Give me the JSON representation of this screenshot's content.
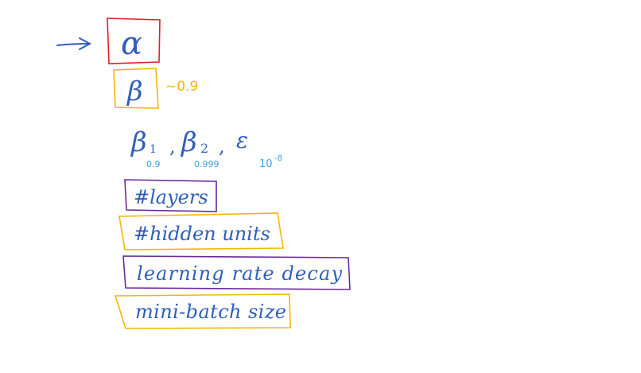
{
  "colors": {
    "ink": "#2f5fb8",
    "red": "#e0202a",
    "yellow": "#f2b705",
    "purple": "#6a2a9a",
    "light_blue": "#3aa0e0"
  },
  "notes": {
    "alpha": "α",
    "beta": "β",
    "beta_value": "~0.9",
    "beta1": "β",
    "beta1_sub": "1",
    "beta1_value": "0.9",
    "beta2": "β",
    "beta2_sub": "2",
    "beta2_value": "0.999",
    "epsilon": "ε",
    "epsilon_value": "10",
    "epsilon_exp": "-8",
    "separator1": ",",
    "separator2": ",",
    "layers": "#layers",
    "hidden_units": "#hidden units",
    "lr_decay": "learning rate decay",
    "mini_batch": "mini-batch size"
  }
}
